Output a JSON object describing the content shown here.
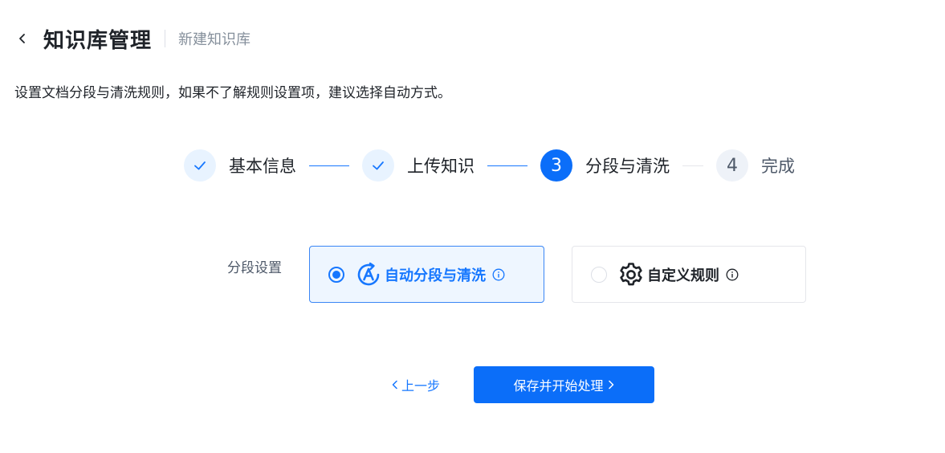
{
  "header": {
    "title": "知识库管理",
    "subtitle": "新建知识库"
  },
  "description": "设置文档分段与清洗规则，如果不了解规则设置项，建议选择自动方式。",
  "steps": [
    {
      "number": "1",
      "label": "基本信息",
      "status": "done"
    },
    {
      "number": "2",
      "label": "上传知识",
      "status": "done"
    },
    {
      "number": "3",
      "label": "分段与清洗",
      "status": "active"
    },
    {
      "number": "4",
      "label": "完成",
      "status": "todo"
    }
  ],
  "segmentation": {
    "label": "分段设置",
    "options": [
      {
        "label": "自动分段与清洗",
        "selected": true,
        "icon": "auto-a-icon"
      },
      {
        "label": "自定义规则",
        "selected": false,
        "icon": "gear-icon"
      }
    ]
  },
  "footer": {
    "prev_label": "上一步",
    "next_label": "保存并开始处理"
  },
  "colors": {
    "primary": "#0b6ef9",
    "selected_bg": "#eef6ff"
  }
}
